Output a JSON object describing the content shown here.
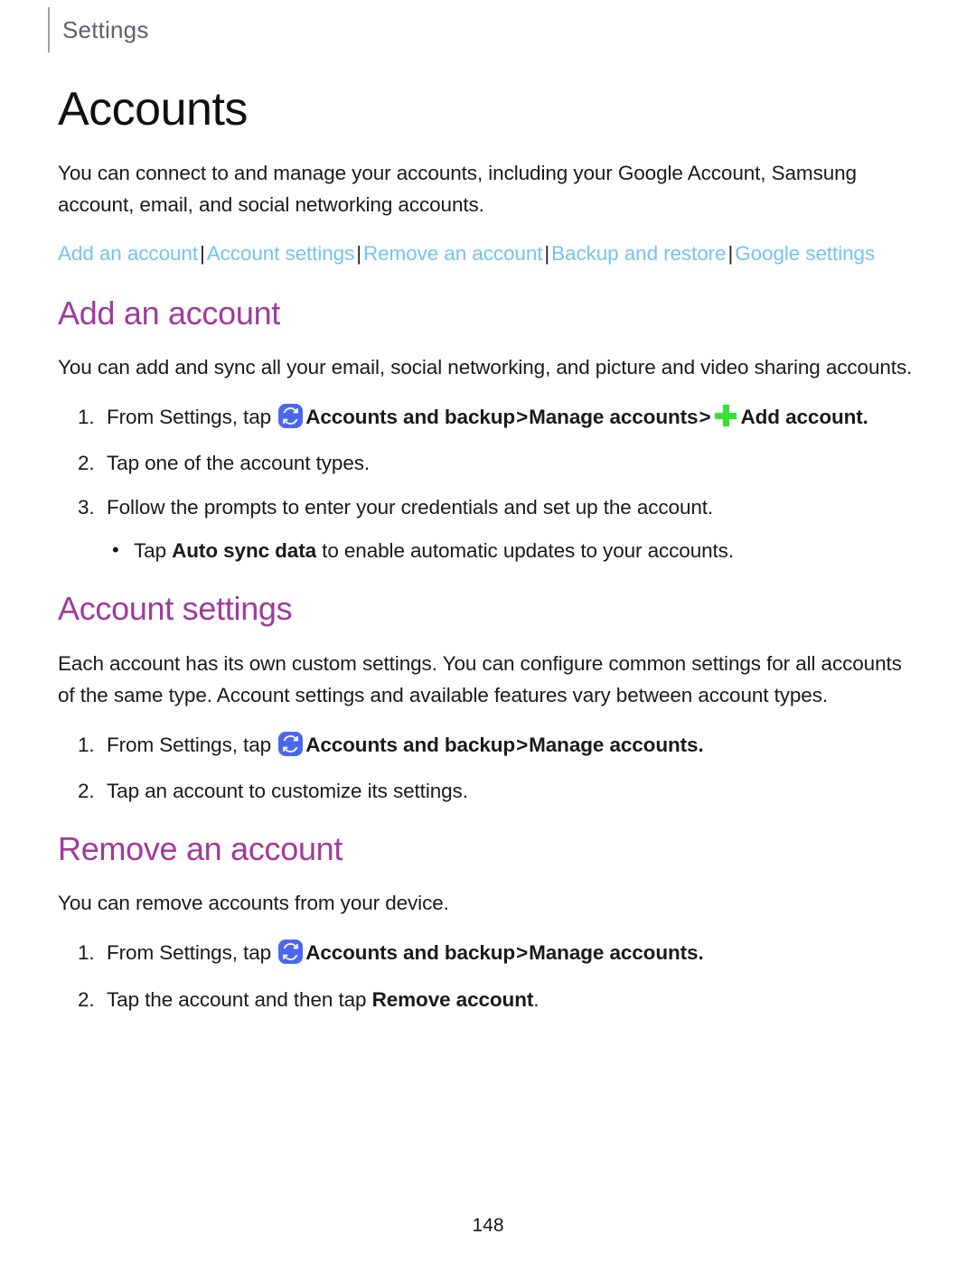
{
  "header": {
    "label": "Settings"
  },
  "page_title": "Accounts",
  "intro": "You can connect to and manage your accounts, including your Google Account, Samsung account, email, and social networking accounts.",
  "link_bar": {
    "separator": "|",
    "links": [
      "Add an account",
      "Account settings",
      "Remove an account",
      "Backup and restore",
      "Google settings"
    ]
  },
  "sections": [
    {
      "heading": "Add an account",
      "body": "You can add and sync all your email, social networking, and picture and video sharing accounts.",
      "steps": [
        {
          "num": "1.",
          "lead": "From Settings, tap",
          "icon": "sync-icon",
          "bold1": "Accounts and backup",
          "arrow1": ">",
          "bold2": "Manage accounts",
          "arrow2": ">",
          "icon2": "plus-icon",
          "bold3": "Add account",
          "tail": "."
        },
        {
          "num": "2.",
          "text": "Tap one of the account types."
        },
        {
          "num": "3.",
          "text": "Follow the prompts to enter your credentials and set up the account."
        }
      ],
      "sub_bullets": [
        {
          "bullet": "•",
          "pre": "Tap ",
          "bold": "Auto sync data",
          "post": " to enable automatic updates to your accounts."
        }
      ]
    },
    {
      "heading": "Account settings",
      "body": "Each account has its own custom settings. You can configure common settings for all accounts of the same type. Account settings and available features vary between account types.",
      "steps": [
        {
          "num": "1.",
          "lead": "From Settings, tap",
          "icon": "sync-icon",
          "bold1": "Accounts and backup",
          "arrow1": ">",
          "bold2": "Manage accounts",
          "tail": "."
        },
        {
          "num": "2.",
          "text": "Tap an account to customize its settings."
        }
      ]
    },
    {
      "heading": "Remove an account",
      "body": "You can remove accounts from your device.",
      "steps": [
        {
          "num": "1.",
          "lead": "From Settings, tap",
          "icon": "sync-icon",
          "bold1": "Accounts and backup",
          "arrow1": ">",
          "bold2": "Manage accounts",
          "tail": "."
        },
        {
          "num": "2.",
          "pre": "Tap the account and then tap ",
          "bold": "Remove account",
          "post": "."
        }
      ]
    }
  ],
  "page_number": "148",
  "colors": {
    "heading_purple": "#a13a9d",
    "link_blue": "#74c3f2",
    "sync_icon_blue": "#4a68ee",
    "plus_icon_green": "#32e332",
    "header_gray": "#5f6368"
  }
}
